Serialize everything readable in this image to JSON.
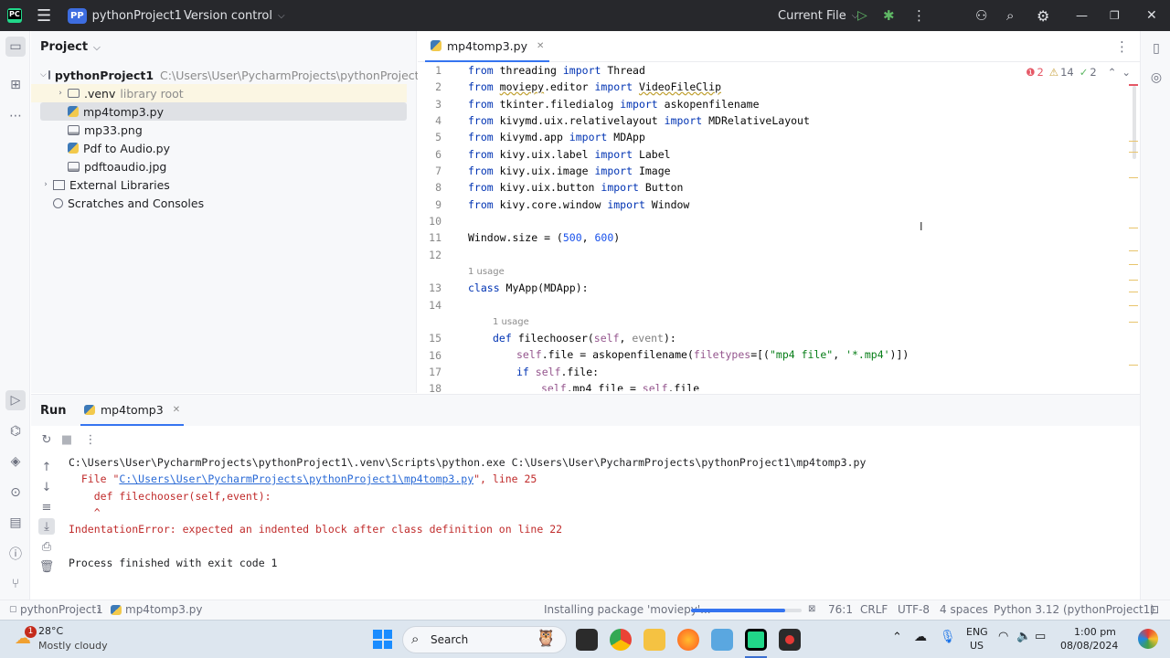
{
  "titlebar": {
    "logo": "PC",
    "project_badge": "PP",
    "project_name": "pythonProject1",
    "vcs_label": "Version control",
    "run_config": "Current File",
    "icons": [
      "hamburger-menu-icon",
      "run-icon",
      "debug-icon",
      "more-icon",
      "add-user-icon",
      "search-icon",
      "settings-icon",
      "minimize-icon",
      "maximize-icon",
      "close-icon"
    ]
  },
  "project_panel": {
    "title": "Project",
    "tree": [
      {
        "name": "pythonProject1",
        "hint": "C:\\Users\\User\\PycharmProjects\\pythonProject1"
      },
      {
        "name": ".venv",
        "hint": "library root"
      },
      {
        "name": "mp4tomp3.py"
      },
      {
        "name": "mp33.png"
      },
      {
        "name": "Pdf to Audio.py"
      },
      {
        "name": "pdftoaudio.jpg"
      },
      {
        "name": "External Libraries"
      },
      {
        "name": "Scratches and Consoles"
      }
    ]
  },
  "editor": {
    "tab_label": "mp4tomp3.py",
    "inspections": {
      "errors": "2",
      "warnings": "14",
      "ok": "2"
    },
    "line_numbers": [
      "1",
      "2",
      "3",
      "4",
      "5",
      "6",
      "7",
      "8",
      "9",
      "10",
      "11",
      "12",
      "13",
      "14",
      "15",
      "16",
      "17",
      "18"
    ],
    "usage_hint": "1 usage",
    "lines": {
      "l1": [
        "from",
        " threading ",
        "import",
        " Thread"
      ],
      "l2": [
        "from",
        " ",
        "moviepy",
        ".editor ",
        "import",
        " ",
        "VideoFileClip"
      ],
      "l3": [
        "from",
        " tkinter.filedialog ",
        "import",
        " askopenfilename"
      ],
      "l4": [
        "from",
        " kivymd.uix.relativelayout ",
        "import",
        " MDRelativeLayout"
      ],
      "l5": [
        "from",
        " kivymd.app ",
        "import",
        " MDApp"
      ],
      "l6": [
        "from",
        " kivy.uix.label ",
        "import",
        " Label"
      ],
      "l7": [
        "from",
        " kivy.uix.image ",
        "import",
        " Image"
      ],
      "l8": [
        "from",
        " kivy.uix.button ",
        "import",
        " Button"
      ],
      "l9": [
        "from",
        " kivy.core.window ",
        "import",
        " Window"
      ],
      "l11": [
        "Window.size = (",
        "500",
        ", ",
        "600",
        ")"
      ],
      "l13": [
        "class",
        " MyApp(MDApp):"
      ],
      "l15": [
        "def",
        " filechooser(",
        "self",
        ", ",
        "event",
        "):"
      ],
      "l16": [
        "self",
        ".file = askopenfilename(",
        "filetypes",
        "=[(",
        "\"mp4 file\"",
        ", ",
        "'*.mp4'",
        ")])"
      ],
      "l17": [
        "if",
        " ",
        "self",
        ".file:"
      ],
      "l18": [
        "self",
        ".mp4_file = ",
        "self",
        ".file"
      ]
    }
  },
  "run_panel": {
    "title": "Run",
    "tab_label": "mp4tomp3",
    "output": {
      "cmd": "C:\\Users\\User\\PycharmProjects\\pythonProject1\\.venv\\Scripts\\python.exe C:\\Users\\User\\PycharmProjects\\pythonProject1\\mp4tomp3.py",
      "file_prefix": "  File \"",
      "file_link": "C:\\Users\\User\\PycharmProjects\\pythonProject1\\mp4tomp3.py",
      "file_suffix": "\", line 25",
      "code_line": "    def filechooser(self,event):",
      "caret": "    ^",
      "error": "IndentationError: expected an indented block after class definition on line 22",
      "exit": "Process finished with exit code 1"
    }
  },
  "statusbar": {
    "breadcrumb_project": "pythonProject1",
    "breadcrumb_file": "mp4tomp3.py",
    "task": "Installing package 'moviepy'...",
    "task_progress": 0.85,
    "position": "76:1",
    "line_sep": "CRLF",
    "encoding": "UTF-8",
    "indent": "4 spaces",
    "interpreter": "Python 3.12 (pythonProject1)"
  },
  "taskbar": {
    "weather_badge": "1",
    "temp": "28°C",
    "weather": "Mostly cloudy",
    "search_label": "Search",
    "lang1": "ENG",
    "lang2": "US",
    "time": "1:00 pm",
    "date": "08/08/2024"
  }
}
